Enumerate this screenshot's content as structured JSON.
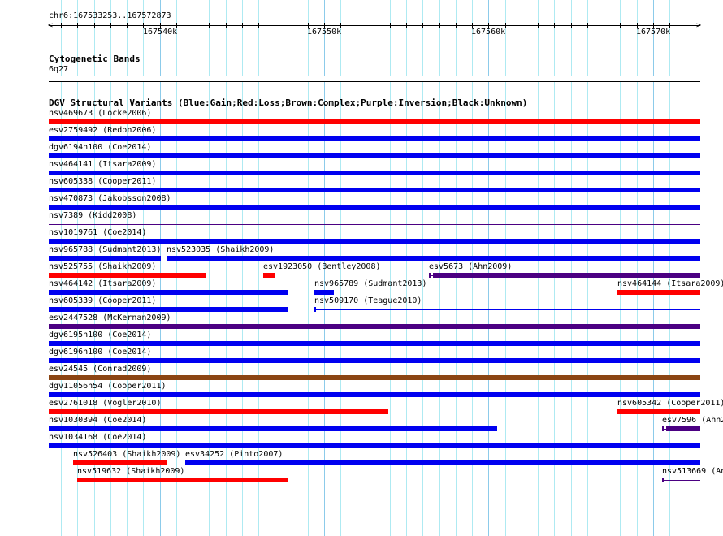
{
  "ruler": {
    "location": "chr6:167533253..167572873",
    "start": 167533253,
    "end": 167572873,
    "major_labels": [
      {
        "pos": 167540000,
        "label": "167540k"
      },
      {
        "pos": 167550000,
        "label": "167550k"
      },
      {
        "pos": 167560000,
        "label": "167560k"
      },
      {
        "pos": 167570000,
        "label": "167570k"
      }
    ]
  },
  "cytoband_track": {
    "title": "Cytogenetic Bands",
    "band": "6q27"
  },
  "dgv_track": {
    "title": "DGV Structural Variants (Blue:Gain;Red:Loss;Brown:Complex;Purple:Inversion;Black:Unknown)",
    "colors": {
      "gain": "#0000f0",
      "loss": "#ff0000",
      "complex": "#8b4513",
      "inversion": "#4b0082"
    },
    "rows": [
      [
        {
          "name": "nsv469673",
          "study": "Locke2006",
          "label": "nsv469673 (Locke2006)",
          "type": "loss",
          "start": 167533253,
          "end": 167572873,
          "style": "bar"
        }
      ],
      [
        {
          "name": "esv2759492",
          "study": "Redon2006",
          "label": "esv2759492 (Redon2006)",
          "type": "gain",
          "start": 167533253,
          "end": 167572873,
          "style": "bar"
        }
      ],
      [
        {
          "name": "dgv6194n100",
          "study": "Coe2014",
          "label": "dgv6194n100 (Coe2014)",
          "type": "gain",
          "start": 167533253,
          "end": 167572873,
          "style": "bar"
        }
      ],
      [
        {
          "name": "nsv464141",
          "study": "Itsara2009",
          "label": "nsv464141 (Itsara2009)",
          "type": "gain",
          "start": 167533253,
          "end": 167572873,
          "style": "bar"
        }
      ],
      [
        {
          "name": "nsv605338",
          "study": "Cooper2011",
          "label": "nsv605338 (Cooper2011)",
          "type": "gain",
          "start": 167533253,
          "end": 167572873,
          "style": "bar"
        }
      ],
      [
        {
          "name": "nsv470873",
          "study": "Jakobsson2008",
          "label": "nsv470873 (Jakobsson2008)",
          "type": "gain",
          "start": 167533253,
          "end": 167572873,
          "style": "bar"
        }
      ],
      [
        {
          "name": "nsv7389",
          "study": "Kidd2008",
          "label": "nsv7389 (Kidd2008)",
          "type": "inversion",
          "start": 167533253,
          "end": 167572873,
          "style": "line"
        }
      ],
      [
        {
          "name": "nsv1019761",
          "study": "Coe2014",
          "label": "nsv1019761 (Coe2014)",
          "type": "gain",
          "start": 167533253,
          "end": 167572873,
          "style": "bar"
        }
      ],
      [
        {
          "name": "nsv965788",
          "study": "Sudmant2013",
          "label": "nsv965788 (Sudmant2013)",
          "type": "gain",
          "start": 167533253,
          "end": 167540080,
          "style": "bar"
        },
        {
          "name": "nsv523035",
          "study": "Shaikh2009",
          "label": "nsv523035 (Shaikh2009)",
          "type": "gain",
          "start": 167540430,
          "end": 167572873,
          "style": "bar"
        }
      ],
      [
        {
          "name": "nsv525755",
          "study": "Shaikh2009",
          "label": "nsv525755 (Shaikh2009)",
          "type": "loss",
          "start": 167533253,
          "end": 167542840,
          "style": "bar"
        },
        {
          "name": "esv1923050",
          "study": "Bentley2008",
          "label": "esv1923050 (Bentley2008)",
          "type": "loss",
          "start": 167546300,
          "end": 167546990,
          "style": "bar"
        },
        {
          "name": "esv5673",
          "study": "Ahn2009",
          "label": "esv5673 (Ahn2009)",
          "type": "inversion",
          "start": 167556370,
          "end": 167572873,
          "style": "bar",
          "cap": true
        }
      ],
      [
        {
          "name": "nsv464142",
          "study": "Itsara2009",
          "label": "nsv464142 (Itsara2009)",
          "type": "gain",
          "start": 167533253,
          "end": 167547780,
          "style": "bar"
        },
        {
          "name": "nsv965789",
          "study": "Sudmant2013",
          "label": "nsv965789 (Sudmant2013)",
          "type": "gain",
          "start": 167549410,
          "end": 167550590,
          "style": "bar"
        },
        {
          "name": "nsv464144",
          "study": "Itsara2009",
          "label": "nsv464144 (Itsara2009)",
          "type": "loss",
          "start": 167567830,
          "end": 167572873,
          "style": "bar"
        }
      ],
      [
        {
          "name": "nsv605339",
          "study": "Cooper2011",
          "label": "nsv605339 (Cooper2011)",
          "type": "gain",
          "start": 167533253,
          "end": 167547780,
          "style": "bar"
        },
        {
          "name": "nsv509170",
          "study": "Teague2010",
          "label": "nsv509170 (Teague2010)",
          "type": "gain",
          "start": 167549410,
          "end": 167572873,
          "style": "line",
          "cap": true
        }
      ],
      [
        {
          "name": "esv2447528",
          "study": "McKernan2009",
          "label": "esv2447528 (McKernan2009)",
          "type": "inversion",
          "start": 167533253,
          "end": 167572873,
          "style": "bar"
        }
      ],
      [
        {
          "name": "dgv6195n100",
          "study": "Coe2014",
          "label": "dgv6195n100 (Coe2014)",
          "type": "gain",
          "start": 167533253,
          "end": 167572873,
          "style": "bar"
        }
      ],
      [
        {
          "name": "dgv6196n100",
          "study": "Coe2014",
          "label": "dgv6196n100 (Coe2014)",
          "type": "gain",
          "start": 167533253,
          "end": 167572873,
          "style": "bar"
        }
      ],
      [
        {
          "name": "esv24545",
          "study": "Conrad2009",
          "label": "esv24545 (Conrad2009)",
          "type": "complex",
          "start": 167533253,
          "end": 167572873,
          "style": "bar"
        }
      ],
      [
        {
          "name": "dgv11056n54",
          "study": "Cooper2011",
          "label": "dgv11056n54 (Cooper2011)",
          "type": "gain",
          "start": 167533253,
          "end": 167572873,
          "style": "bar"
        }
      ],
      [
        {
          "name": "esv2761018",
          "study": "Vogler2010",
          "label": "esv2761018 (Vogler2010)",
          "type": "loss",
          "start": 167533253,
          "end": 167553900,
          "style": "bar"
        },
        {
          "name": "nsv605342",
          "study": "Cooper2011",
          "label": "nsv605342 (Cooper2011)",
          "type": "loss",
          "start": 167567830,
          "end": 167572873,
          "style": "bar"
        }
      ],
      [
        {
          "name": "nsv1030394",
          "study": "Coe2014",
          "label": "nsv1030394 (Coe2014)",
          "type": "gain",
          "start": 167533253,
          "end": 167560520,
          "style": "bar"
        },
        {
          "name": "esv7596",
          "study": "Ahn2",
          "label": "esv7596 (Ahn2",
          "type": "inversion",
          "start": 167570550,
          "end": 167572873,
          "style": "bar",
          "cap": true
        }
      ],
      [
        {
          "name": "nsv1034168",
          "study": "Coe2014",
          "label": "nsv1034168 (Coe2014)",
          "type": "gain",
          "start": 167533253,
          "end": 167572873,
          "style": "bar"
        }
      ],
      [
        {
          "name": "nsv526403",
          "study": "Shaikh2009",
          "label": "nsv526403 (Shaikh2009)",
          "type": "loss",
          "start": 167534740,
          "end": 167540470,
          "style": "bar"
        },
        {
          "name": "esv34252",
          "study": "Pinto2007",
          "label": "esv34252 (Pinto2007)",
          "type": "gain",
          "start": 167541550,
          "end": 167572873,
          "style": "bar"
        }
      ],
      [
        {
          "name": "nsv519632",
          "study": "Shaikh2009",
          "label": "nsv519632 (Shaikh2009)",
          "type": "loss",
          "start": 167534980,
          "end": 167547780,
          "style": "bar"
        },
        {
          "name": "nsv513669",
          "study": "An",
          "label": "nsv513669 (An",
          "type": "inversion",
          "start": 167570550,
          "end": 167572873,
          "style": "line",
          "cap": true
        }
      ]
    ]
  }
}
